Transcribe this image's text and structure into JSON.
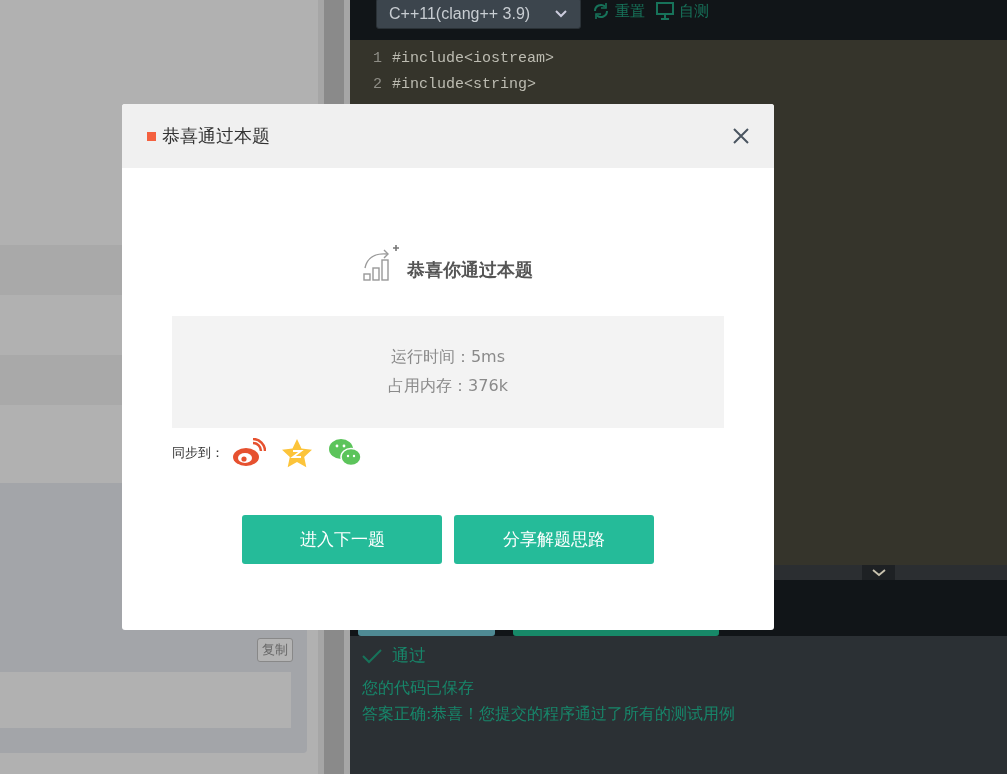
{
  "left_panel": {
    "copy_button": "复制"
  },
  "toolbar": {
    "language": "C++11(clang++ 3.9)",
    "actions": [
      "重置",
      "自测"
    ]
  },
  "editor": {
    "lines": [
      {
        "number": "1",
        "code": "#include<iostream>"
      },
      {
        "number": "2",
        "code": "#include<string>"
      }
    ]
  },
  "result": {
    "status": "通过",
    "messages": [
      "您的代码已保存",
      "答案正确:恭喜！您提交的程序通过了所有的测试用例"
    ]
  },
  "dialog": {
    "title": "恭喜通过本题",
    "heading": "恭喜你通过本题",
    "stats": [
      "运行时间：5ms",
      "占用内存：376k"
    ],
    "share_label": "同步到：",
    "buttons": [
      "进入下一题",
      "分享解题思路"
    ]
  }
}
